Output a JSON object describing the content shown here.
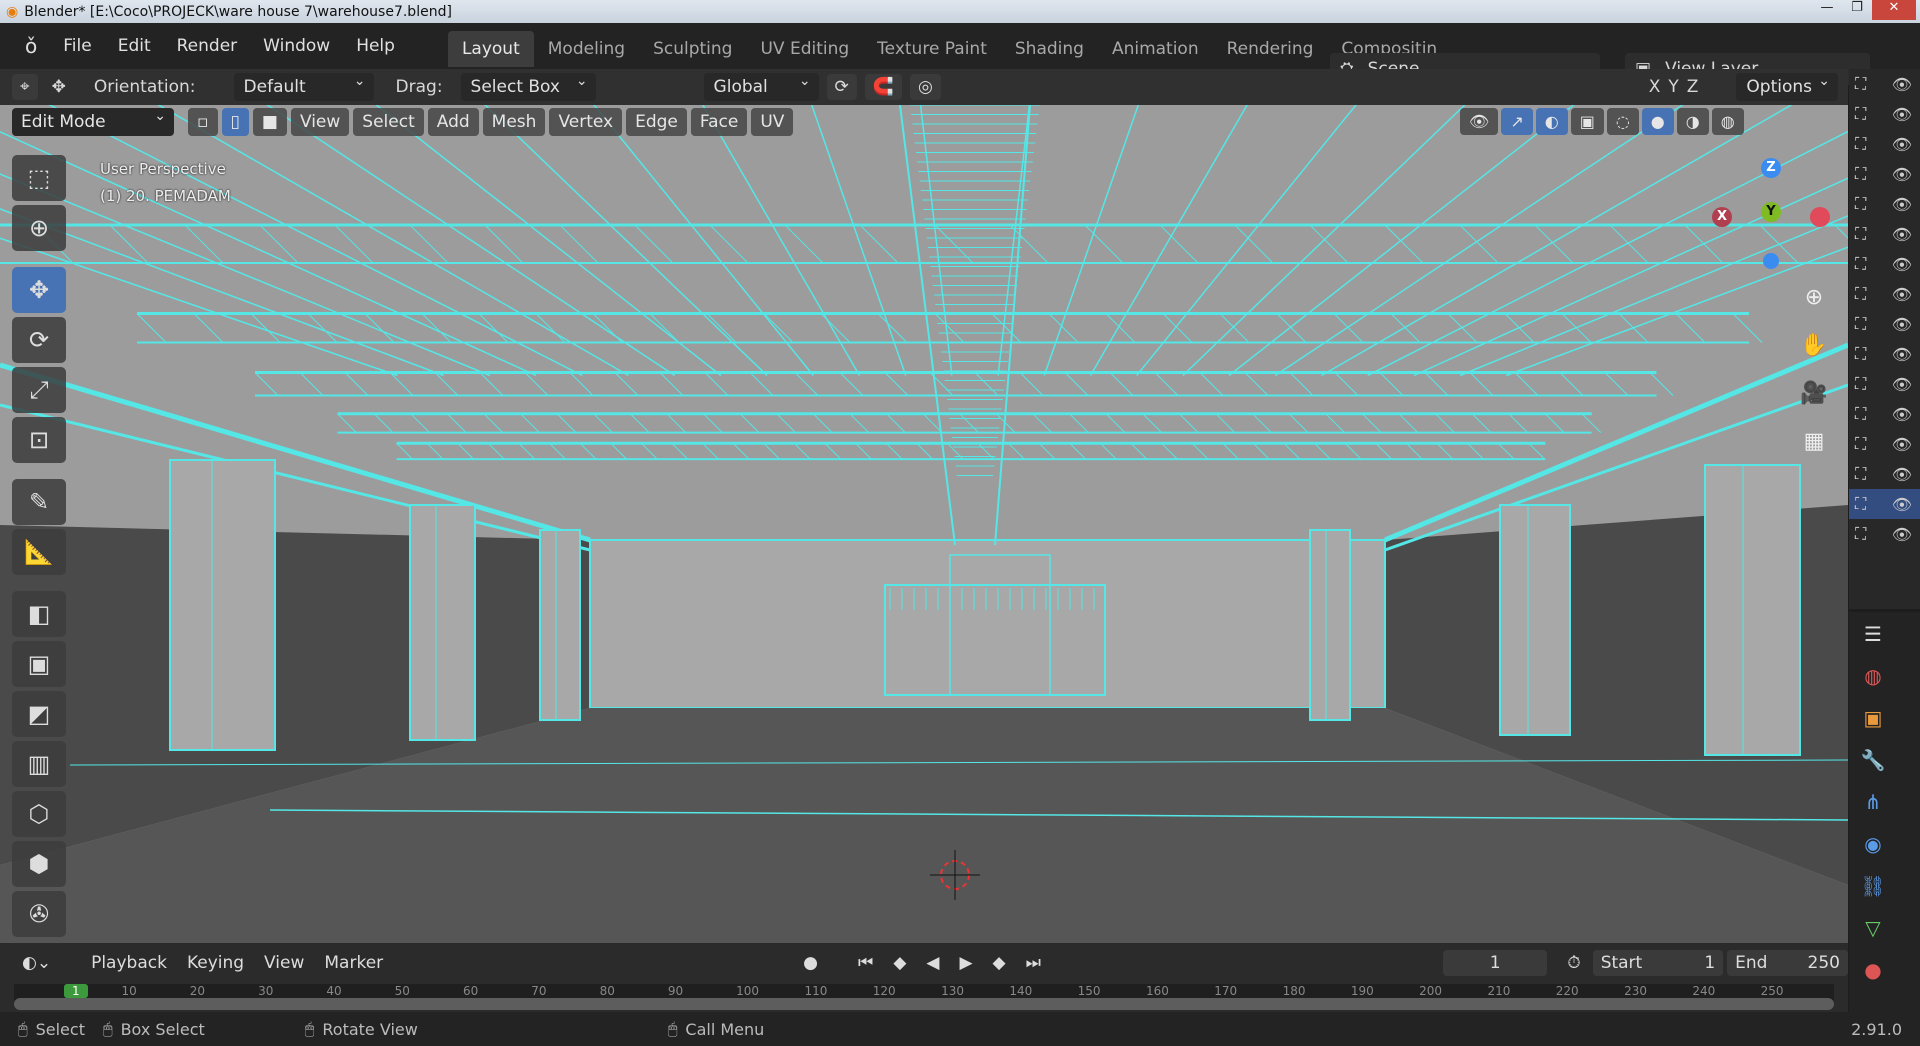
{
  "window": {
    "title": "Blender* [E:\\Coco\\PROJECK\\ware house 7\\warehouse7.blend]",
    "min": "—",
    "max": "❐",
    "close": "✕"
  },
  "menu": [
    "File",
    "Edit",
    "Render",
    "Window",
    "Help"
  ],
  "workspaces": [
    {
      "label": "Layout",
      "active": true
    },
    {
      "label": "Modeling"
    },
    {
      "label": "Sculpting"
    },
    {
      "label": "UV Editing"
    },
    {
      "label": "Texture Paint"
    },
    {
      "label": "Shading"
    },
    {
      "label": "Animation"
    },
    {
      "label": "Rendering"
    },
    {
      "label": "Compositin"
    }
  ],
  "scene": {
    "name": "Scene",
    "view_layer": "View Layer"
  },
  "toolheader": {
    "orientation_label": "Orientation:",
    "orientation": "Default",
    "drag_label": "Drag:",
    "drag": "Select Box",
    "transform": "Global",
    "axes": [
      "X",
      "Y",
      "Z"
    ],
    "options": "Options"
  },
  "viewport_header": {
    "mode": "Edit Mode",
    "menus": [
      "View",
      "Select",
      "Add",
      "Mesh",
      "Vertex",
      "Edge",
      "Face",
      "UV"
    ]
  },
  "overlay": {
    "perspective": "User Perspective",
    "object": "(1) 20. PEMADAM"
  },
  "gizmo": {
    "x": "X",
    "y": "Y",
    "z": "Z",
    "x_color": "#e04a5a",
    "y_color": "#7fbb23",
    "z_color": "#3a8cf0"
  },
  "colors": {
    "wire": "#55e6e6",
    "accent": "#4772b3",
    "viewport_bg": "#a4a4a4",
    "floor": "#565656"
  },
  "timeline": {
    "menus": [
      "Playback",
      "Keying",
      "View",
      "Marker"
    ],
    "current_frame": "1",
    "start_label": "Start",
    "start": "1",
    "end_label": "End",
    "end": "250",
    "ticks": [
      "1",
      "10",
      "20",
      "30",
      "40",
      "50",
      "60",
      "70",
      "80",
      "90",
      "100",
      "110",
      "120",
      "130",
      "140",
      "150",
      "160",
      "170",
      "180",
      "190",
      "200",
      "210",
      "220",
      "230",
      "240",
      "250"
    ]
  },
  "status": {
    "select": "Select",
    "box_select": "Box Select",
    "rotate": "Rotate View",
    "call_menu": "Call Menu",
    "version": "2.91.0"
  }
}
